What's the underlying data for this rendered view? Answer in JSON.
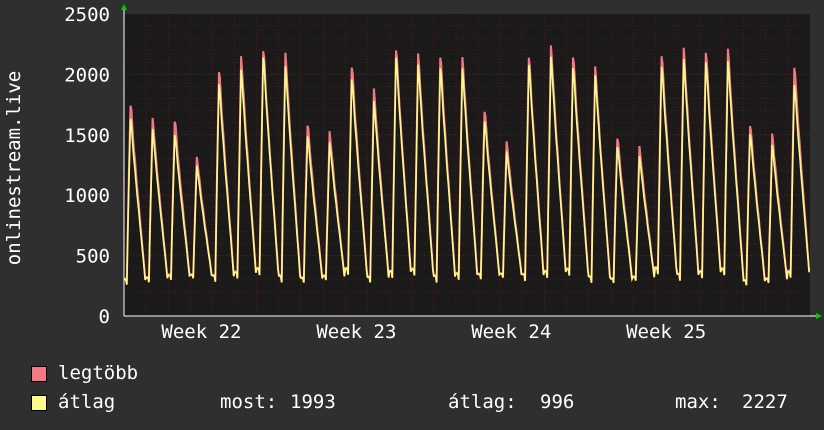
{
  "chart_data": {
    "type": "line",
    "ylabel": "onlinestream.live",
    "ylim": [
      0,
      2500
    ],
    "yticks": [
      0,
      500,
      1000,
      1500,
      2000,
      2500
    ],
    "x_tick_labels": [
      "Week 22",
      "Week 23",
      "Week 24",
      "Week 25"
    ],
    "days_per_week": 7,
    "grid": true,
    "legend_position": "bottom-left",
    "series": [
      {
        "name": "legtöbb",
        "color": "#f47983",
        "daily_peaks": [
          1820,
          1690,
          1680,
          1350,
          2110,
          2220,
          2290,
          2250,
          1650,
          1570,
          2150,
          1940,
          2300,
          2240,
          2240,
          2210,
          1770,
          1480,
          2240,
          2310,
          2240,
          2130,
          1540,
          1440,
          2250,
          2290,
          2280,
          2280,
          1650,
          1550,
          2150
        ]
      },
      {
        "name": "átlag",
        "color": "#fbfb8c",
        "daily_peaks": [
          1700,
          1600,
          1560,
          1280,
          2000,
          2110,
          2230,
          2140,
          1550,
          1480,
          2040,
          1840,
          2230,
          2150,
          2140,
          2120,
          1680,
          1400,
          2170,
          2220,
          2140,
          2060,
          1460,
          1360,
          2150,
          2200,
          2190,
          2180,
          1570,
          1460,
          1993
        ]
      }
    ],
    "stats": {
      "last_label": "most:",
      "last_value": "1993",
      "avg_label": "átlag:",
      "avg_value": "996",
      "max_label": "max:",
      "max_value": "2227"
    },
    "colors": {
      "background": "#2f2f2f",
      "plot_background": "#1a1a1a",
      "grid_minor": "#5a1515",
      "grid_major": "#6b1a1a",
      "axis": "#ffffff",
      "arrow": "#00cc00"
    }
  }
}
